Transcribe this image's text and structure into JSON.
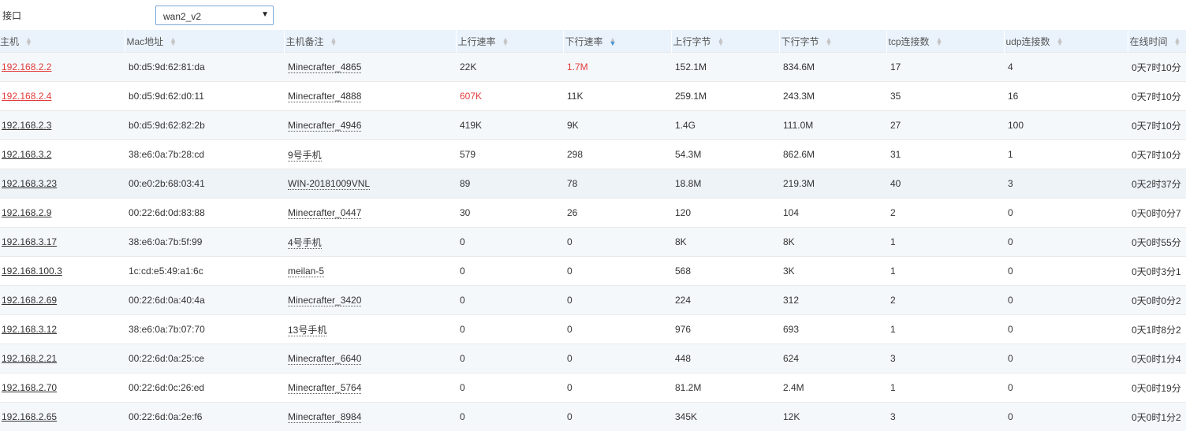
{
  "filter": {
    "label": "接口",
    "selected": "wan2_v2"
  },
  "columns": [
    {
      "label": "主机",
      "sorted": false
    },
    {
      "label": "Mac地址",
      "sorted": false
    },
    {
      "label": "主机备注",
      "sorted": false
    },
    {
      "label": "上行速率",
      "sorted": false
    },
    {
      "label": "下行速率",
      "sorted": true
    },
    {
      "label": "上行字节",
      "sorted": false
    },
    {
      "label": "下行字节",
      "sorted": false
    },
    {
      "label": "tcp连接数",
      "sorted": false
    },
    {
      "label": "udp连接数",
      "sorted": false
    },
    {
      "label": "在线时间",
      "sorted": false
    }
  ],
  "rows": [
    {
      "host": "192.168.2.2",
      "mac": "b0:d5:9d:62:81:da",
      "note": "Minecrafter_4865",
      "up_rate": "22K",
      "down_rate": "1.7M",
      "up_bytes": "152.1M",
      "down_bytes": "834.6M",
      "tcp": "17",
      "udp": "4",
      "online": "0天7时10分"
    },
    {
      "host": "192.168.2.4",
      "mac": "b0:d5:9d:62:d0:11",
      "note": "Minecrafter_4888",
      "up_rate": "607K",
      "down_rate": "11K",
      "up_bytes": "259.1M",
      "down_bytes": "243.3M",
      "tcp": "35",
      "udp": "16",
      "online": "0天7时10分"
    },
    {
      "host": "192.168.2.3",
      "mac": "b0:d5:9d:62:82:2b",
      "note": "Minecrafter_4946",
      "up_rate": "419K",
      "down_rate": "9K",
      "up_bytes": "1.4G",
      "down_bytes": "111.0M",
      "tcp": "27",
      "udp": "100",
      "online": "0天7时10分"
    },
    {
      "host": "192.168.3.2",
      "mac": "38:e6:0a:7b:28:cd",
      "note": "9号手机",
      "up_rate": "579",
      "down_rate": "298",
      "up_bytes": "54.3M",
      "down_bytes": "862.6M",
      "tcp": "31",
      "udp": "1",
      "online": "0天7时10分"
    },
    {
      "host": "192.168.3.23",
      "mac": "00:e0:2b:68:03:41",
      "note": "WIN-20181009VNL",
      "up_rate": "89",
      "down_rate": "78",
      "up_bytes": "18.8M",
      "down_bytes": "219.3M",
      "tcp": "40",
      "udp": "3",
      "online": "0天2时37分"
    },
    {
      "host": "192.168.2.9",
      "mac": "00:22:6d:0d:83:88",
      "note": "Minecrafter_0447",
      "up_rate": "30",
      "down_rate": "26",
      "up_bytes": "120",
      "down_bytes": "104",
      "tcp": "2",
      "udp": "0",
      "online": "0天0时0分7"
    },
    {
      "host": "192.168.3.17",
      "mac": "38:e6:0a:7b:5f:99",
      "note": "4号手机",
      "up_rate": "0",
      "down_rate": "0",
      "up_bytes": "8K",
      "down_bytes": "8K",
      "tcp": "1",
      "udp": "0",
      "online": "0天0时55分"
    },
    {
      "host": "192.168.100.3",
      "mac": "1c:cd:e5:49:a1:6c",
      "note": "meilan-5",
      "up_rate": "0",
      "down_rate": "0",
      "up_bytes": "568",
      "down_bytes": "3K",
      "tcp": "1",
      "udp": "0",
      "online": "0天0时3分1"
    },
    {
      "host": "192.168.2.69",
      "mac": "00:22:6d:0a:40:4a",
      "note": "Minecrafter_3420",
      "up_rate": "0",
      "down_rate": "0",
      "up_bytes": "224",
      "down_bytes": "312",
      "tcp": "2",
      "udp": "0",
      "online": "0天0时0分2"
    },
    {
      "host": "192.168.3.12",
      "mac": "38:e6:0a:7b:07:70",
      "note": "13号手机",
      "up_rate": "0",
      "down_rate": "0",
      "up_bytes": "976",
      "down_bytes": "693",
      "tcp": "1",
      "udp": "0",
      "online": "0天1时8分2"
    },
    {
      "host": "192.168.2.21",
      "mac": "00:22:6d:0a:25:ce",
      "note": "Minecrafter_6640",
      "up_rate": "0",
      "down_rate": "0",
      "up_bytes": "448",
      "down_bytes": "624",
      "tcp": "3",
      "udp": "0",
      "online": "0天0时1分4"
    },
    {
      "host": "192.168.2.70",
      "mac": "00:22:6d:0c:26:ed",
      "note": "Minecrafter_5764",
      "up_rate": "0",
      "down_rate": "0",
      "up_bytes": "81.2M",
      "down_bytes": "2.4M",
      "tcp": "1",
      "udp": "0",
      "online": "0天0时19分"
    },
    {
      "host": "192.168.2.65",
      "mac": "00:22:6d:0a:2e:f6",
      "note": "Minecrafter_8984",
      "up_rate": "0",
      "down_rate": "0",
      "up_bytes": "345K",
      "down_bytes": "12K",
      "tcp": "3",
      "udp": "0",
      "online": "0天0时1分2"
    }
  ],
  "highlight": {
    "red_hosts": [
      "192.168.2.2",
      "192.168.2.4"
    ],
    "red_cells": [
      {
        "row": 0,
        "col": "down_rate"
      },
      {
        "row": 1,
        "col": "up_rate"
      }
    ],
    "hover_row": 4,
    "accent": "#e23c3c",
    "sort_color": "#4a90d9"
  }
}
